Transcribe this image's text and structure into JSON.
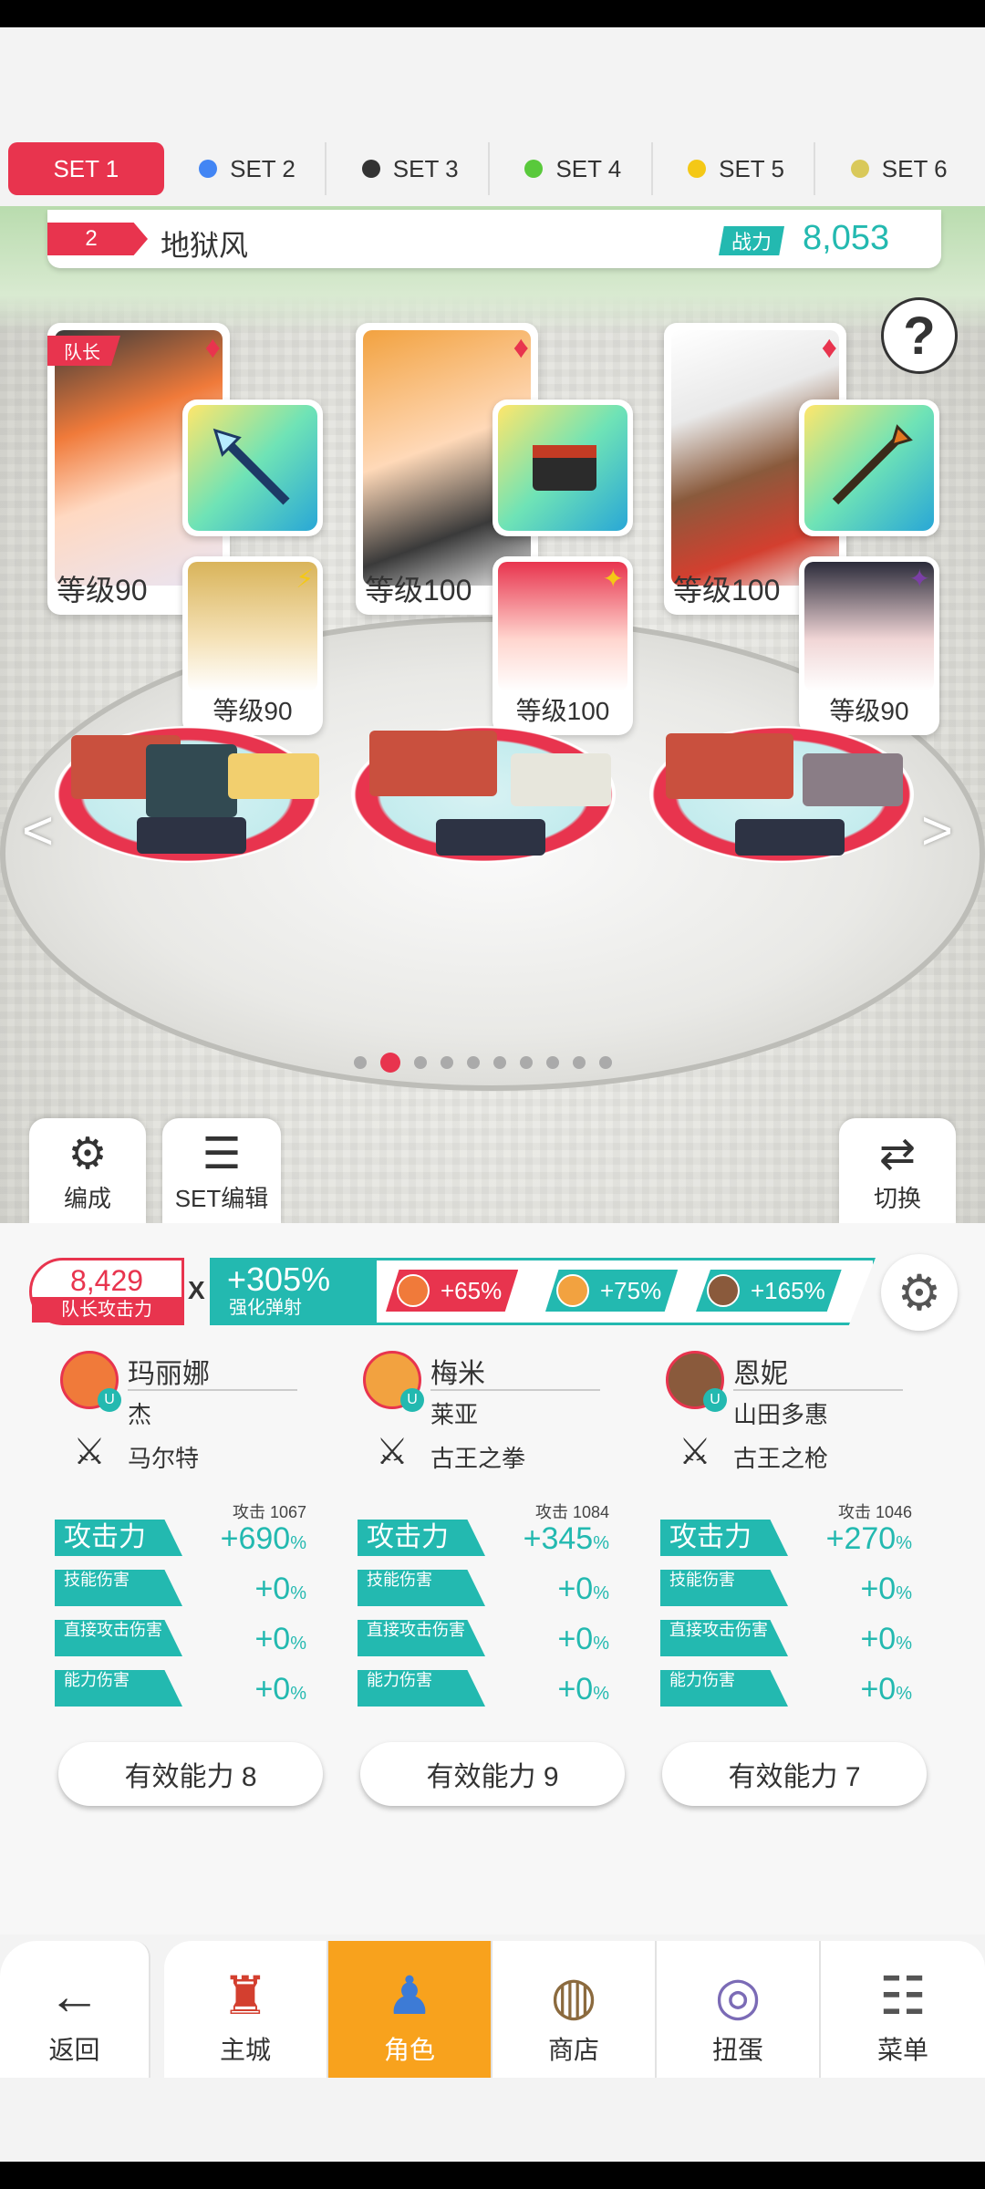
{
  "set_tabs": [
    {
      "label": "SET 1",
      "active": true,
      "dot": ""
    },
    {
      "label": "SET 2",
      "active": false,
      "dot": "#4285f4"
    },
    {
      "label": "SET 3",
      "active": false,
      "dot": "#333333"
    },
    {
      "label": "SET 4",
      "active": false,
      "dot": "#59c93b"
    },
    {
      "label": "SET 5",
      "active": false,
      "dot": "#f4c816"
    },
    {
      "label": "SET 6",
      "active": false,
      "dot": "#d9c95a"
    }
  ],
  "team": {
    "number": "2",
    "name": "地狱风",
    "power_label": "战力",
    "power_value": "8,053"
  },
  "help_label": "?",
  "leader_tag": "队长",
  "heroes": [
    {
      "level": "等级90",
      "sub_level": "等级90",
      "sub_badge": "⚡",
      "weapon_icon": "spear-icon"
    },
    {
      "level": "等级100",
      "sub_level": "等级100",
      "sub_badge": "✦",
      "weapon_icon": "gauntlet-icon"
    },
    {
      "level": "等级100",
      "sub_level": "等级90",
      "sub_badge": "✦",
      "weapon_icon": "lance-icon"
    }
  ],
  "nav_arrows": {
    "left": "<",
    "right": ">"
  },
  "pager": {
    "count": 10,
    "active_index": 1
  },
  "side_buttons": {
    "formation": "编成",
    "set_edit": "SET编辑",
    "switch": "切换"
  },
  "leader_attack": {
    "value": "8,429",
    "label": "队长攻击力"
  },
  "multiplier_sign": "X",
  "buff_main": {
    "value": "+305%",
    "label": "强化弹射"
  },
  "buff_chips": [
    {
      "value": "+65%",
      "color": "#e8344e"
    },
    {
      "value": "+75%",
      "color": "#23b9b0"
    },
    {
      "value": "+165%",
      "color": "#23b9b0"
    }
  ],
  "columns": [
    {
      "name": "玛丽娜",
      "sub": "杰",
      "weapon": "马尔特",
      "atk_cap": "攻击 1067",
      "stats": [
        {
          "label": "攻击力",
          "value": "+690",
          "unit": "%"
        },
        {
          "label": "技能伤害",
          "value": "+0",
          "unit": "%"
        },
        {
          "label": "直接攻击伤害",
          "value": "+0",
          "unit": "%"
        },
        {
          "label": "能力伤害",
          "value": "+0",
          "unit": "%"
        }
      ],
      "effective": "有效能力 8"
    },
    {
      "name": "梅米",
      "sub": "莱亚",
      "weapon": "古王之拳",
      "atk_cap": "攻击 1084",
      "stats": [
        {
          "label": "攻击力",
          "value": "+345",
          "unit": "%"
        },
        {
          "label": "技能伤害",
          "value": "+0",
          "unit": "%"
        },
        {
          "label": "直接攻击伤害",
          "value": "+0",
          "unit": "%"
        },
        {
          "label": "能力伤害",
          "value": "+0",
          "unit": "%"
        }
      ],
      "effective": "有效能力 9"
    },
    {
      "name": "恩妮",
      "sub": "山田多惠",
      "weapon": "古王之枪",
      "atk_cap": "攻击 1046",
      "stats": [
        {
          "label": "攻击力",
          "value": "+270",
          "unit": "%"
        },
        {
          "label": "技能伤害",
          "value": "+0",
          "unit": "%"
        },
        {
          "label": "直接攻击伤害",
          "value": "+0",
          "unit": "%"
        },
        {
          "label": "能力伤害",
          "value": "+0",
          "unit": "%"
        }
      ],
      "effective": "有效能力 7"
    }
  ],
  "bottom_nav": [
    {
      "label": "返回",
      "icon": "back-arrow-icon",
      "active": false
    },
    {
      "label": "主城",
      "icon": "castle-icon",
      "active": false
    },
    {
      "label": "角色",
      "icon": "character-icon",
      "active": true
    },
    {
      "label": "商店",
      "icon": "shop-icon",
      "active": false
    },
    {
      "label": "扭蛋",
      "icon": "gacha-icon",
      "active": false
    },
    {
      "label": "菜单",
      "icon": "menu-icon",
      "active": false
    }
  ],
  "colors": {
    "accent_red": "#e8344e",
    "accent_teal": "#23b9b0",
    "nav_active": "#f8a21d"
  }
}
